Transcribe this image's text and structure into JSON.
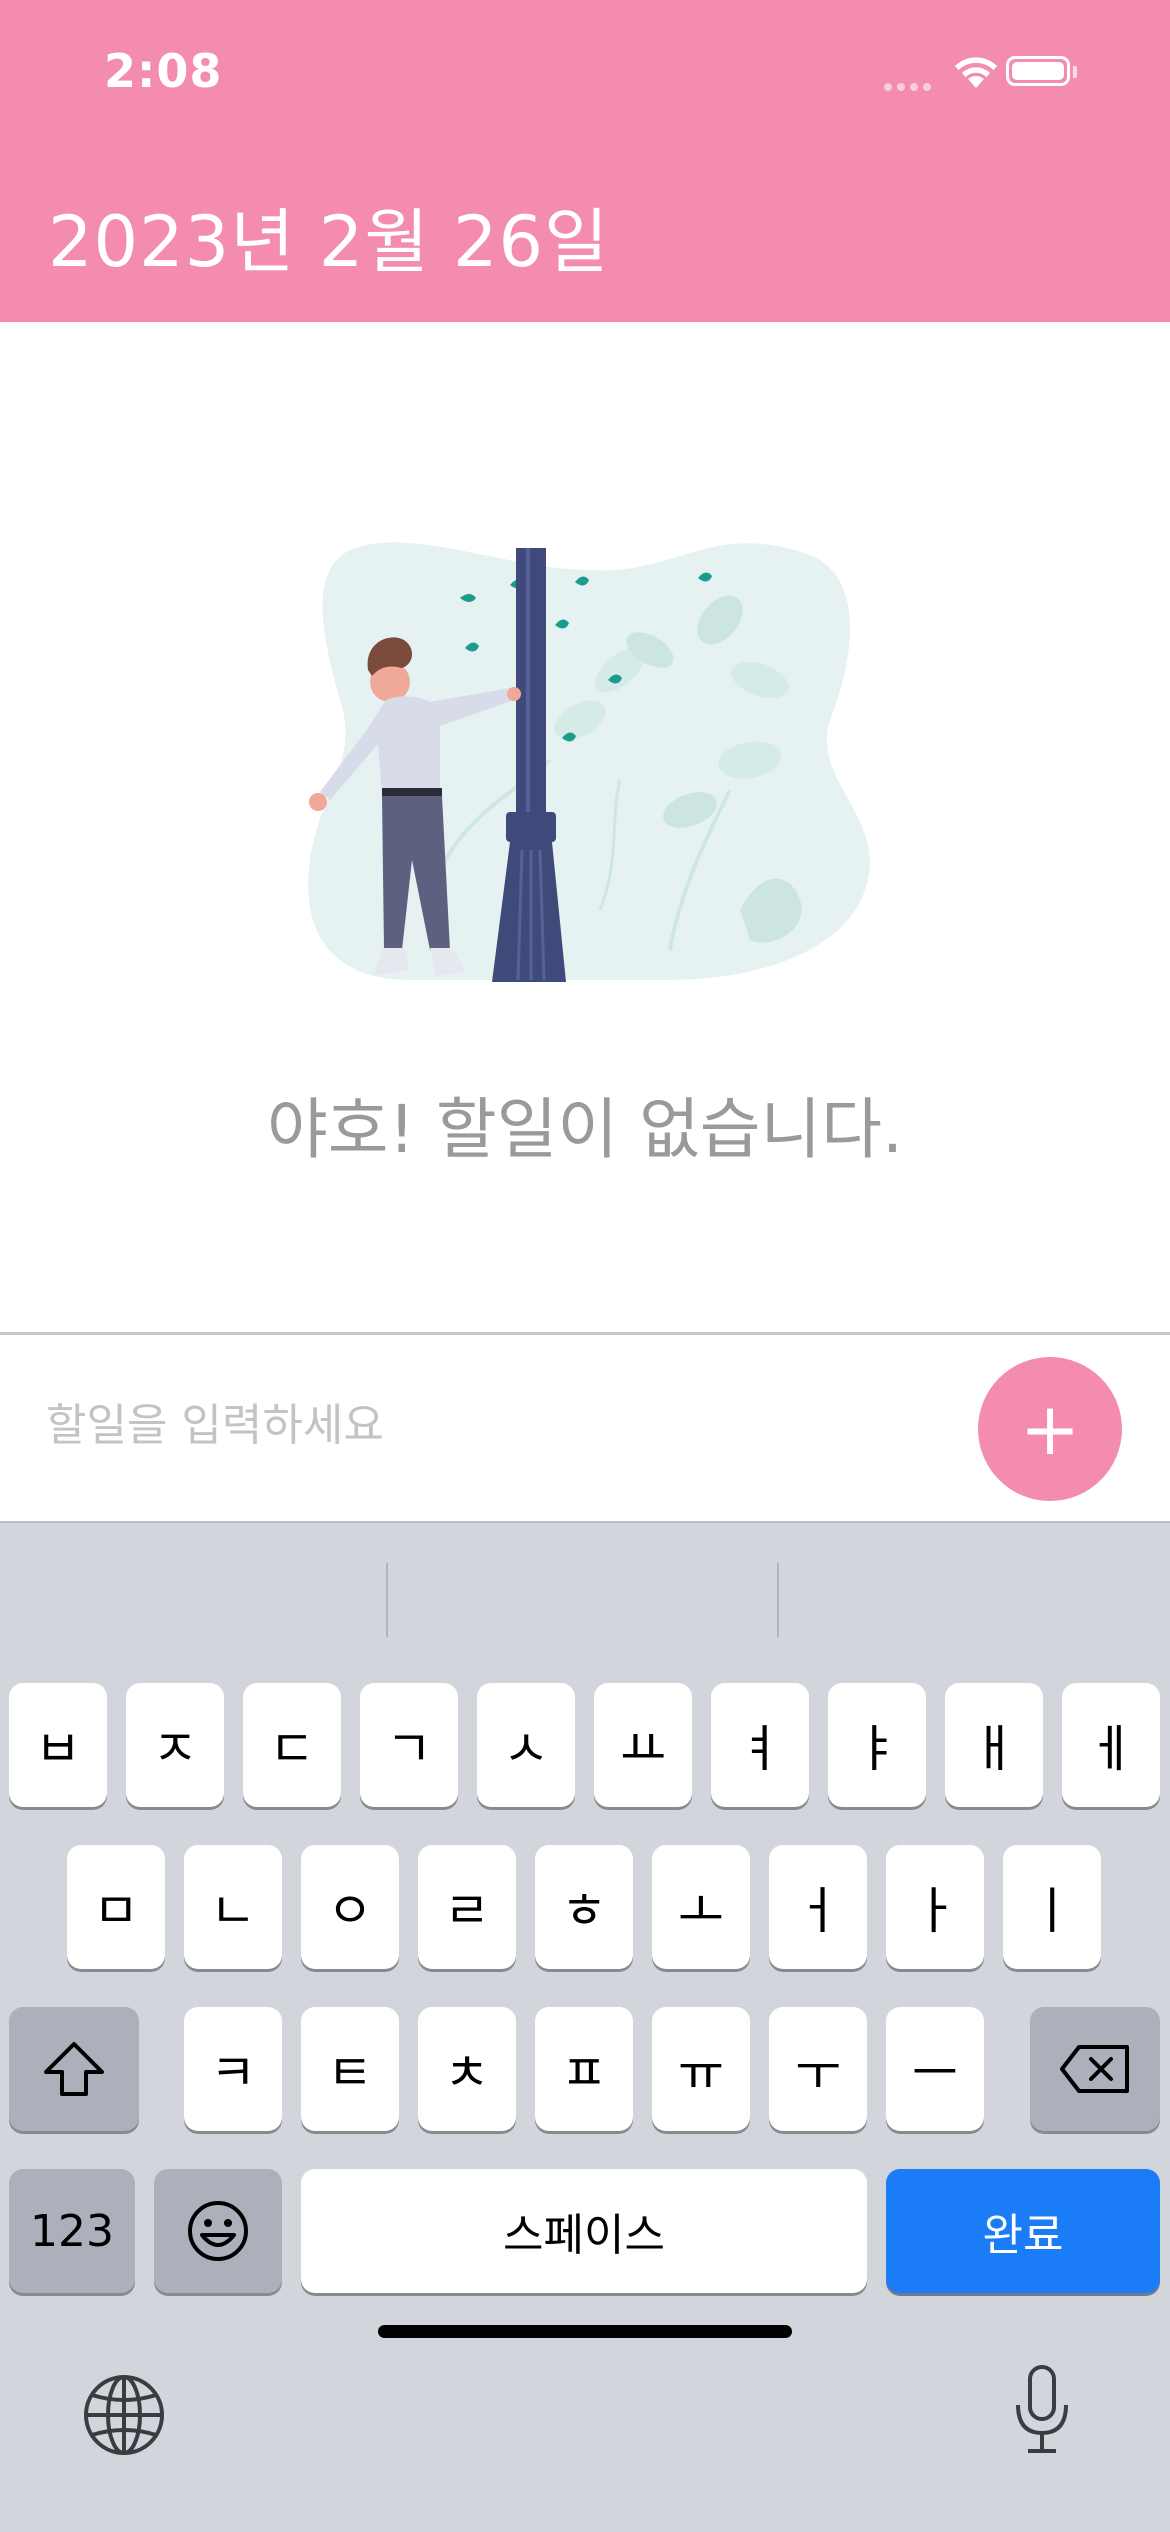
{
  "status_bar": {
    "time": "2:08"
  },
  "header": {
    "date_title": "2023년 2월 26일"
  },
  "empty_state": {
    "message": "야호! 할일이 없습니다.",
    "illustration": "person-leaning-on-lamp-post"
  },
  "input_bar": {
    "placeholder": "할일을 입력하세요",
    "value": "",
    "add_label": "+"
  },
  "keyboard": {
    "row1": [
      "ㅂ",
      "ㅈ",
      "ㄷ",
      "ㄱ",
      "ㅅ",
      "ㅛ",
      "ㅕ",
      "ㅑ",
      "ㅐ",
      "ㅔ"
    ],
    "row2": [
      "ㅁ",
      "ㄴ",
      "ㅇ",
      "ㄹ",
      "ㅎ",
      "ㅗ",
      "ㅓ",
      "ㅏ",
      "ㅣ"
    ],
    "row3": [
      "ㅋ",
      "ㅌ",
      "ㅊ",
      "ㅍ",
      "ㅠ",
      "ㅜ",
      "ㅡ"
    ],
    "numbers_label": "123",
    "space_label": "스페이스",
    "done_label": "완료",
    "icons": [
      "shift-icon",
      "backspace-icon",
      "emoji-icon",
      "globe-icon",
      "microphone-icon"
    ]
  },
  "colors": {
    "accent": "#f48caf",
    "keyboard_bg": "#d2d5db",
    "done_blue": "#1a7cf6"
  }
}
